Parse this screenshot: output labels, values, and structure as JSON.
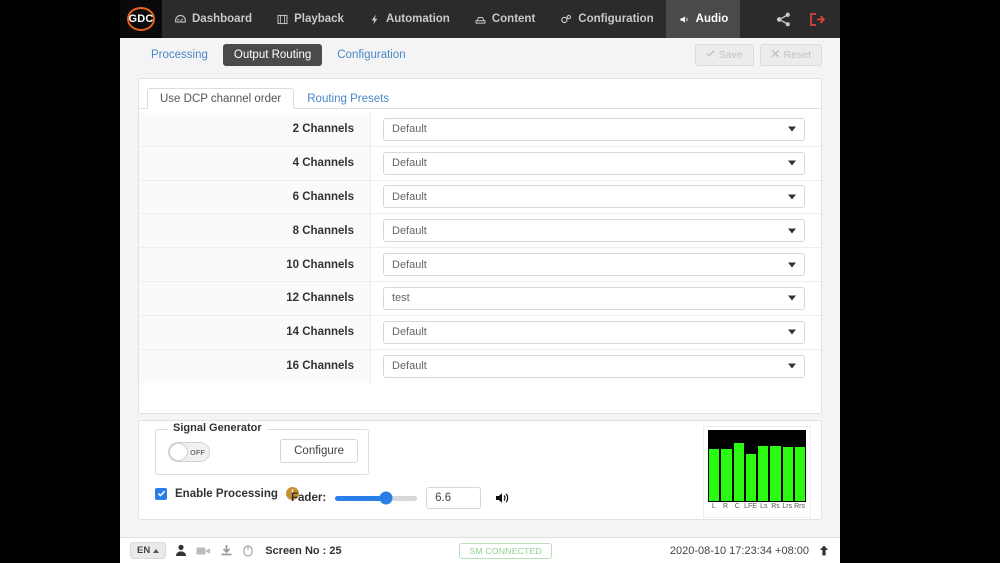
{
  "topnav": {
    "logo_text": "GDC",
    "items": [
      {
        "label": "Dashboard",
        "icon": "dashboard-icon",
        "active": false
      },
      {
        "label": "Playback",
        "icon": "film-icon",
        "active": false
      },
      {
        "label": "Automation",
        "icon": "bolt-icon",
        "active": false
      },
      {
        "label": "Content",
        "icon": "drive-icon",
        "active": false
      },
      {
        "label": "Configuration",
        "icon": "gears-icon",
        "active": false
      },
      {
        "label": "Audio",
        "icon": "speaker-icon",
        "active": true
      }
    ],
    "right_icons": [
      {
        "name": "share-icon"
      },
      {
        "name": "logout-icon"
      }
    ]
  },
  "subnav": {
    "tabs": [
      {
        "label": "Processing",
        "active": false
      },
      {
        "label": "Output Routing",
        "active": true
      },
      {
        "label": "Configuration",
        "active": false
      }
    ],
    "save_label": "Save",
    "reset_label": "Reset"
  },
  "panel": {
    "tabs": [
      {
        "label": "Use DCP channel order",
        "active": true
      },
      {
        "label": "Routing Presets",
        "active": false
      }
    ],
    "rows": [
      {
        "label": "2 Channels",
        "value": "Default"
      },
      {
        "label": "4 Channels",
        "value": "Default"
      },
      {
        "label": "6 Channels",
        "value": "Default"
      },
      {
        "label": "8 Channels",
        "value": "Default"
      },
      {
        "label": "10 Channels",
        "value": "Default"
      },
      {
        "label": "12 Channels",
        "value": "test"
      },
      {
        "label": "14 Channels",
        "value": "Default"
      },
      {
        "label": "16 Channels",
        "value": "Default"
      }
    ]
  },
  "bottom": {
    "signal_generator": {
      "legend": "Signal Generator",
      "toggle_state": "OFF",
      "configure_label": "Configure"
    },
    "enable_processing": {
      "label": "Enable Processing",
      "checked": true,
      "warning_glyph": "!"
    },
    "fader": {
      "label": "Fader:",
      "value": "6.6",
      "percent": 62
    },
    "meters": {
      "labels": [
        "L",
        "R",
        "C",
        "LFE",
        "Ls",
        "Rs",
        "Lrs",
        "Rrs"
      ],
      "levels": [
        78,
        78,
        86,
        70,
        82,
        82,
        80,
        80
      ],
      "color": "#2bfb12"
    }
  },
  "statusbar": {
    "language": "EN",
    "icons": [
      "user-icon",
      "camera-icon",
      "download-icon",
      "mouse-icon"
    ],
    "screen_label": "Screen No : 25",
    "connection_badge": "SM CONNECTED",
    "timestamp": "2020-08-10 17:23:34 +08:00",
    "up_icon": "arrow-up-icon"
  }
}
